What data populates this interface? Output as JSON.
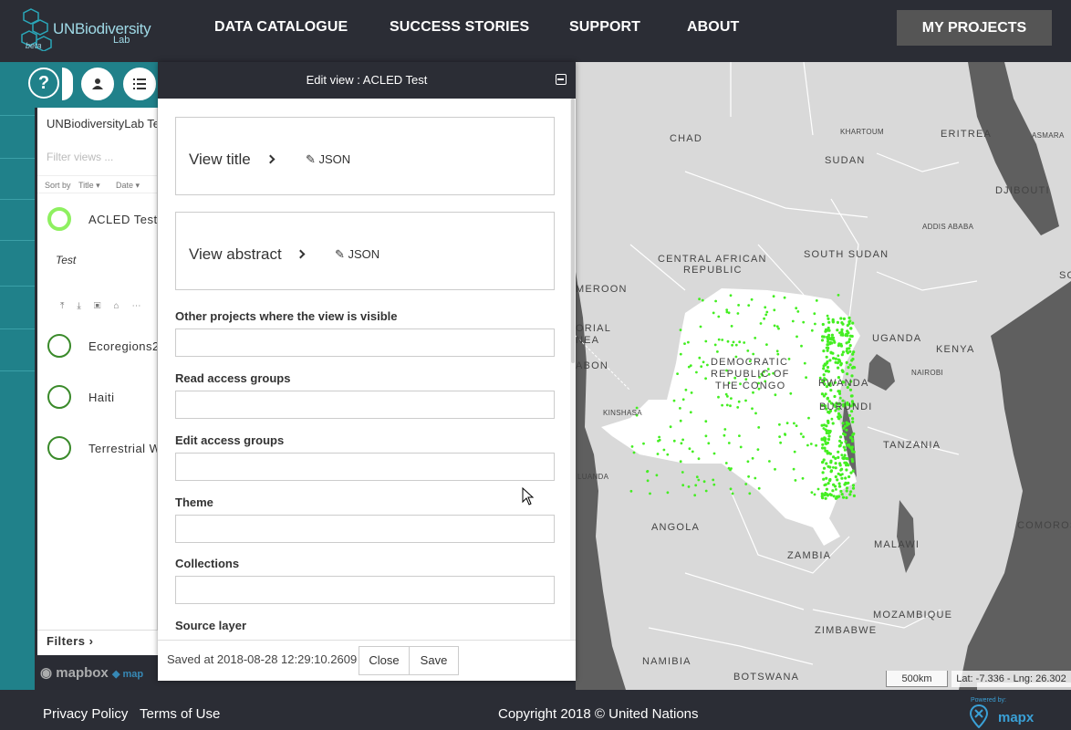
{
  "nav": {
    "logo_text": "UNBiodiversity",
    "logo_sub": "Lab",
    "logo_beta": "beta",
    "links": [
      "DATA CATALOGUE",
      "SUCCESS STORIES",
      "SUPPORT",
      "ABOUT"
    ],
    "my_projects": "MY PROJECTS"
  },
  "sidebar": {
    "help_label": "?",
    "project_title": "UNBiodiversityLab Te",
    "filter_placeholder": "Filter views ...",
    "sort_by": "Sort by",
    "sort_title": "Title",
    "sort_date": "Date",
    "views": [
      {
        "label": "ACLED Test",
        "active": true
      },
      {
        "label": "Ecoregions2",
        "active": false
      },
      {
        "label": "Haiti",
        "active": false
      },
      {
        "label": "Terrestrial W",
        "active": false
      }
    ],
    "active_description": "Test",
    "filters_label": "Filters",
    "mapbox_label": "mapbox",
    "map_partial": "map"
  },
  "edit_panel": {
    "title": "Edit view : ACLED Test",
    "view_title_label": "View title",
    "view_abstract_label": "View abstract",
    "json_label": "JSON",
    "fields": [
      "Other projects where the view is visible",
      "Read access groups",
      "Edit access groups",
      "Theme",
      "Collections",
      "Source layer"
    ],
    "saved_text": "Saved at 2018-08-28 12:29:10.2609",
    "close_label": "Close",
    "save_label": "Save"
  },
  "map": {
    "labels": {
      "chad": "CHAD",
      "sudan": "SUDAN",
      "eritrea": "ERITREA",
      "djibouti": "DJIBOUTI",
      "car": "CENTRAL AFRICAN",
      "car2": "REPUBLIC",
      "south_sudan": "SOUTH SUDAN",
      "cameroon": "MEROON",
      "drc1": "DEMOCRATIC",
      "drc2": "REPUBLIC OF",
      "drc3": "THE CONGO",
      "uganda": "UGANDA",
      "kenya": "KENYA",
      "rwanda": "RWANDA",
      "burundi": "BURUNDI",
      "tanzania": "TANZANIA",
      "angola": "ANGOLA",
      "zambia": "ZAMBIA",
      "malawi": "MALAWI",
      "mozambique": "MOZAMBIQUE",
      "zimbabwe": "ZIMBABWE",
      "namibia": "NAMIBIA",
      "botswana": "BOTSWANA",
      "comoros": "COMOROS",
      "gabon": "ABON",
      "eq_guinea1": "ORIAL",
      "eq_guinea2": "NEA",
      "khartoum": "KHARTOUM",
      "addis": "ADDIS ABABA",
      "kinshasa": "KINSHASA",
      "nairobi": "NAIROBI",
      "asmara": "ASMARA",
      "somalia": "SO",
      "luanda": "LUANDA"
    },
    "scale": "500km",
    "coords": "Lat: -7.336 - Lng: 26.302"
  },
  "footer": {
    "privacy": "Privacy Policy",
    "terms": "Terms of Use",
    "copyright": "Copyright 2018 © United Nations",
    "powered_by": "Powered by:",
    "mapx": "mapx"
  },
  "colors": {
    "teal": "#20818a",
    "dark": "#2b2d35",
    "points": "#44ee22",
    "mapx_blue": "#3aa0d6"
  }
}
